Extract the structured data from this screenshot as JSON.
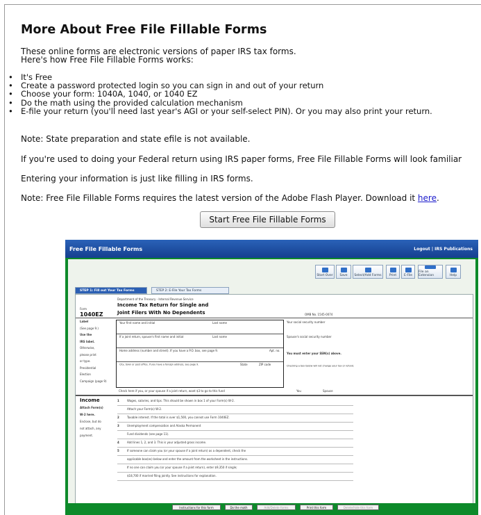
{
  "heading": "More About Free File Fillable Forms",
  "intro": [
    "These online forms are electronic versions of paper IRS tax forms.",
    "Here's how Free File Fillable Forms works:"
  ],
  "bullets": [
    "It's Free",
    "Create a password protected login so you can sign in and out of your return",
    "Choose your form: 1040A, 1040, or 1040 EZ",
    "Do the math using the provided calculation mechanism",
    "E-file your return (you'll need last year's AGI or your self-select PIN). Or you may also print your return."
  ],
  "note_state": "Note: State preparation and state efile is not available.",
  "familiar": "If you're used to doing your Federal return using IRS paper forms, Free File Fillable Forms will look familiar",
  "entering": "Entering your information is just like filling in IRS forms.",
  "flash_note_prefix": "Note: Free File Fillable Forms requires the latest version of the Adobe Flash Player. Download it ",
  "flash_link": "here",
  "flash_suffix": ".",
  "start_button": "Start Free File Fillable Forms",
  "preview": {
    "title": "Free File Fillable Forms",
    "top_links": "Logout  |  IRS Publications",
    "toolbar": [
      "Start Over",
      "Save",
      "Select/Add Forms",
      "Print",
      "E-File",
      "File an Extension",
      "Help"
    ],
    "tabs": [
      "STEP 1:  Fill out Your Tax Forms",
      "STEP 2:  E-File Your Tax Forms"
    ],
    "form_dept": "Department of the Treasury - Internal Revenue Service",
    "form_label": "Form",
    "form_number": "1040EZ",
    "form_title_1": "Income Tax Return for Single and",
    "form_title_2": "Joint Filers With No Dependents",
    "omb": "OMB No. 1545-0074",
    "left_labels": [
      "Label",
      "(See page 9.)",
      "Use the",
      "IRS label.",
      "Otherwise,",
      "please print",
      "or type.",
      "Presidential",
      "Election",
      "Campaign (page 9)"
    ],
    "fields": [
      "Your first name and initial",
      "Last name",
      "Your social security number",
      "If a joint return, spouse's first name and initial",
      "Last name",
      "Spouse's social security number",
      "Home address (number and street). If you have a P.O. box, see page 9.",
      "Apt. no.",
      "You must enter your SSN(s) above.",
      "City, town or post office. If you have a foreign address, see page 9.",
      "State",
      "ZIP code",
      "Checking a box below will not change your tax or refund.",
      "Check here if you, or your spouse if a joint return, want $3 to go to this fund"
    ],
    "yes": "You",
    "spouse": "Spouse",
    "income_header": "Income",
    "income_left": [
      "Attach Form(s)",
      "W-2 here.",
      "Enclose, but do",
      "not attach, any",
      "payment."
    ],
    "lines": [
      {
        "n": "1",
        "t": "Wages, salaries, and tips. This should be shown in box 1 of your Form(s) W-2."
      },
      {
        "n": "",
        "t": "Attach your Form(s) W-2."
      },
      {
        "n": "2",
        "t": "Taxable interest. If the total is over $1,500, you cannot use Form 1040EZ."
      },
      {
        "n": "3",
        "t": "Unemployment compensation and Alaska Permanent"
      },
      {
        "n": "",
        "t": "Fund dividends (see page 11)."
      },
      {
        "n": "4",
        "t": "Add lines 1, 2, and 3. This is your adjusted gross income."
      },
      {
        "n": "5",
        "t": "If someone can claim you (or your spouse if a joint return) as a dependent, check the"
      },
      {
        "n": "",
        "t": "applicable box(es) below and enter the amount from the worksheet in the instructions."
      },
      {
        "n": "",
        "t": "If no one can claim you (or your spouse if a joint return), enter $9,350 if single;"
      },
      {
        "n": "",
        "t": "$18,700 if married filing jointly. See instructions for explanation."
      }
    ],
    "bottom_buttons": [
      "Instructions for this form",
      "Do the math",
      "Add/Delete forms",
      "Print this form",
      "Delete/hide this form"
    ]
  }
}
